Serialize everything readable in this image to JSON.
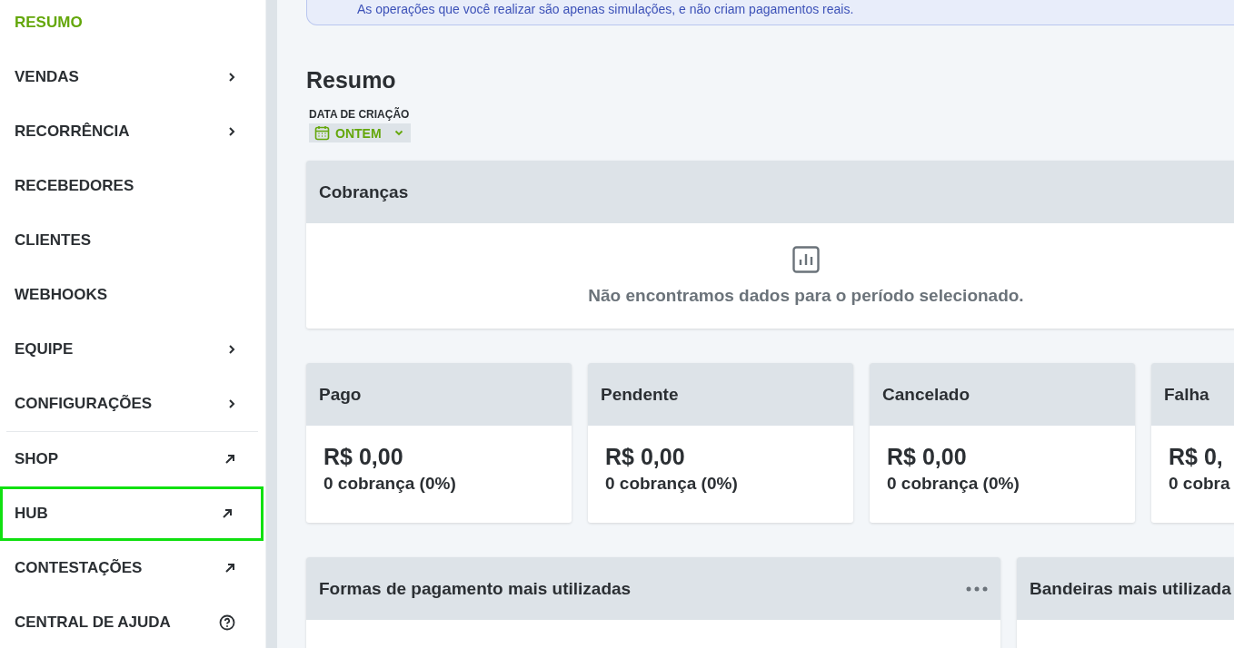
{
  "banner": {
    "text": "As operações que você realizar são apenas simulações, e não criam pagamentos reais."
  },
  "sidebar": {
    "groups": [
      {
        "items": [
          {
            "label": "RESUMO",
            "selected": true,
            "highlighted": false,
            "kind": "plain"
          },
          {
            "label": "VENDAS",
            "selected": false,
            "highlighted": false,
            "kind": "submenu"
          },
          {
            "label": "RECORRÊNCIA",
            "selected": false,
            "highlighted": false,
            "kind": "submenu"
          },
          {
            "label": "RECEBEDORES",
            "selected": false,
            "highlighted": false,
            "kind": "plain"
          },
          {
            "label": "CLIENTES",
            "selected": false,
            "highlighted": false,
            "kind": "plain"
          },
          {
            "label": "WEBHOOKS",
            "selected": false,
            "highlighted": false,
            "kind": "plain"
          },
          {
            "label": "EQUIPE",
            "selected": false,
            "highlighted": false,
            "kind": "submenu"
          },
          {
            "label": "CONFIGURAÇÕES",
            "selected": false,
            "highlighted": false,
            "kind": "submenu"
          }
        ]
      },
      {
        "items": [
          {
            "label": "SHOP",
            "selected": false,
            "highlighted": false,
            "kind": "external"
          },
          {
            "label": "HUB",
            "selected": false,
            "highlighted": true,
            "kind": "external"
          },
          {
            "label": "CONTESTAÇÕES",
            "selected": false,
            "highlighted": false,
            "kind": "external"
          },
          {
            "label": "CENTRAL DE AJUDA",
            "selected": false,
            "highlighted": false,
            "kind": "help"
          }
        ]
      }
    ]
  },
  "page": {
    "title": "Resumo",
    "filter": {
      "label": "DATA DE CRIAÇÃO",
      "value": "ONTEM"
    }
  },
  "charges_panel": {
    "title": "Cobranças",
    "empty_message": "Não encontramos dados para o período selecionado."
  },
  "stat_cards": [
    {
      "title": "Pago",
      "amount": "R$ 0,00",
      "count": "0 cobrança (0%)"
    },
    {
      "title": "Pendente",
      "amount": "R$ 0,00",
      "count": "0 cobrança (0%)"
    },
    {
      "title": "Cancelado",
      "amount": "R$ 0,00",
      "count": "0 cobrança (0%)"
    },
    {
      "title": "Falha",
      "amount": "R$ 0,",
      "count": "0 cobra"
    }
  ],
  "bottom_panels": [
    {
      "title": "Formas de pagamento mais utilizadas",
      "menu": true
    },
    {
      "title": "Bandeiras mais utilizada",
      "menu": false
    }
  ]
}
